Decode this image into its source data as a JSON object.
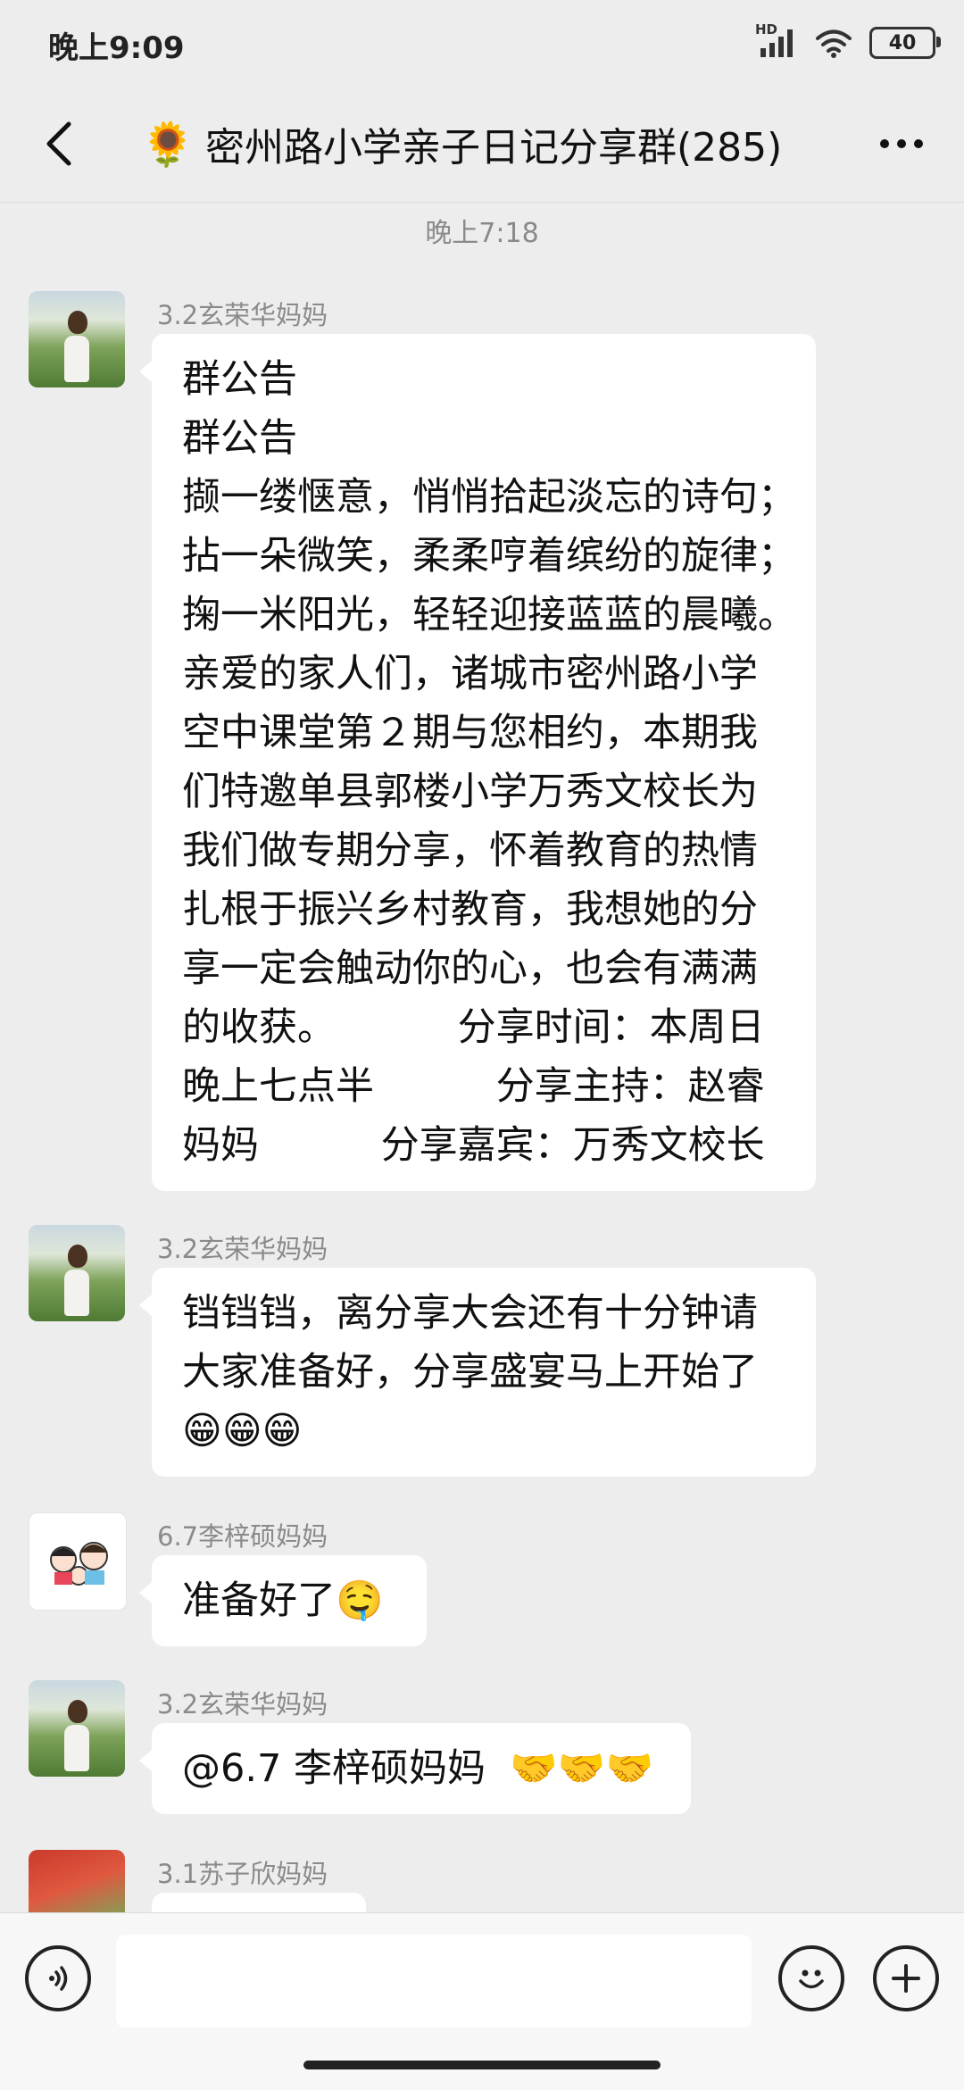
{
  "status_bar": {
    "time": "晚上9:09",
    "network": "HD",
    "battery": "40"
  },
  "header": {
    "title_emoji": "🌻",
    "title": "密州路小学亲子日记分享群(285)"
  },
  "chat": {
    "timestamp": "晚上7:18",
    "messages": [
      {
        "sender": "3.2玄荣华妈妈",
        "lines": [
          "群公告",
          "群公告",
          "撷一缕惬意，悄悄拾起淡忘的诗句；",
          "拈一朵微笑，柔柔哼着缤纷的旋律；",
          "掬一米阳光，轻轻迎接蓝蓝的晨曦。",
          "亲爱的家人们，诸城市密州路小学",
          "空中课堂第２期与您相约，本期我",
          "们特邀单县郭楼小学万秀文校长为",
          "我们做专期分享，怀着教育的热情",
          "扎根于振兴乡村教育，我想她的分",
          "享一定会触动你的心，也会有满满",
          "的收获。          分享时间：本周日",
          "晚上七点半          分享主持：赵睿",
          "妈妈          分享嘉宾：万秀文校长"
        ]
      },
      {
        "sender": "3.2玄荣华妈妈",
        "lines": [
          "铛铛铛，离分享大会还有十分钟请",
          "大家准备好，分享盛宴马上开始了",
          "😁😁😁"
        ]
      },
      {
        "sender": "6.7李梓硕妈妈",
        "lines": [
          "准备好了🤤"
        ]
      },
      {
        "sender": "3.2玄荣华妈妈",
        "lines": [
          "@6.7 李梓硕妈妈  🤝🤝🤝"
        ]
      },
      {
        "sender": "3.1苏子欣妈妈",
        "lines": []
      }
    ]
  },
  "input_bar": {
    "value": "",
    "placeholder": ""
  },
  "icons": {
    "back": "back-arrow-icon",
    "more": "more-dots-icon",
    "voice": "voice-icon",
    "emoji": "emoji-icon",
    "plus": "plus-icon"
  }
}
